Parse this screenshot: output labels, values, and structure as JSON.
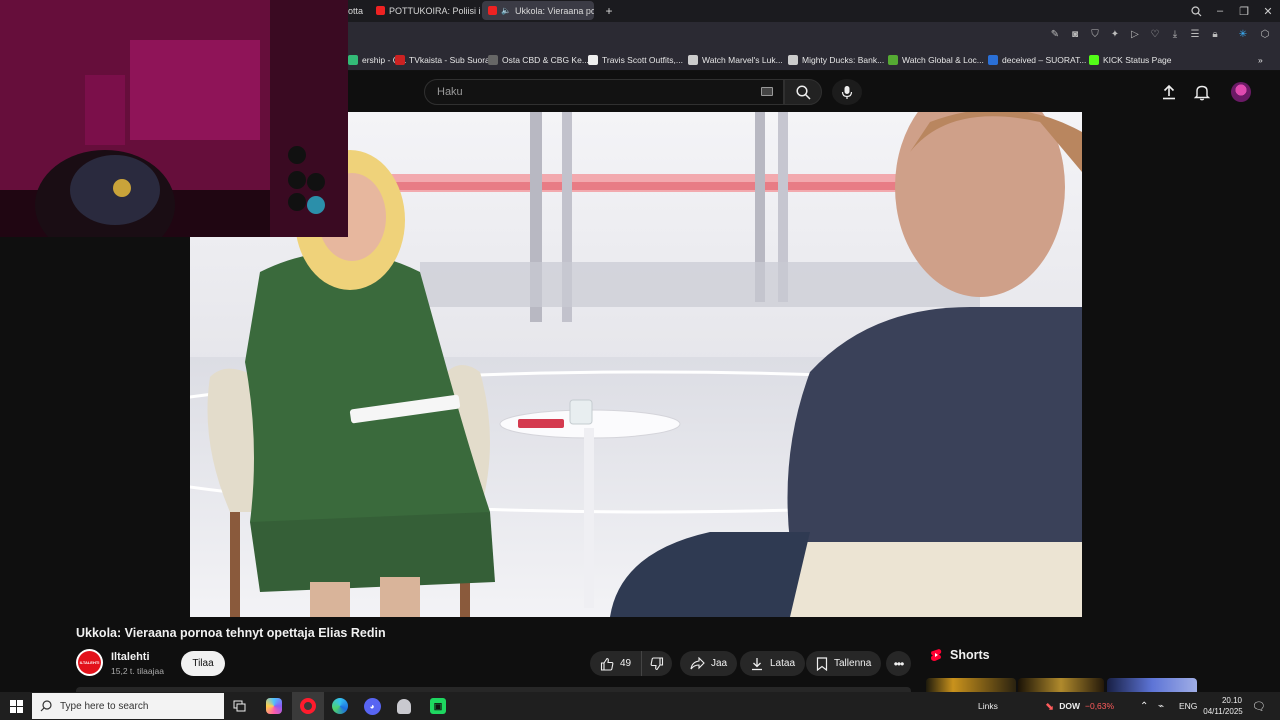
{
  "browser": {
    "tabs": [
      {
        "label": "otta",
        "active": false
      },
      {
        "label": "POTTUKOIRA: Poliisi iskee",
        "active": false
      },
      {
        "label": "Ukkola: Vieraana porno",
        "active": true
      }
    ],
    "new_tab": "+",
    "bookmarks": [
      {
        "label": "ership - G...",
        "color": "#3b7"
      },
      {
        "label": "TVkaista - Sub Suora",
        "color": "#c22"
      },
      {
        "label": "Osta CBD & CBG Ke...",
        "color": "#666"
      },
      {
        "label": "Travis Scott Outfits,...",
        "color": "#eee"
      },
      {
        "label": "Watch Marvel's Luk...",
        "color": "#ccc"
      },
      {
        "label": "Mighty Ducks: Bank...",
        "color": "#ccc"
      },
      {
        "label": "Watch Global & Loc...",
        "color": "#5a3"
      },
      {
        "label": "deceived – SUORAT...",
        "color": "#2a6fd6"
      },
      {
        "label": "KICK Status Page",
        "color": "#53fc18"
      }
    ]
  },
  "youtube": {
    "search_placeholder": "Haku",
    "video_title": "Ukkola: Vieraana pornoa tehnyt opettaja Elias Redin",
    "channel": {
      "name": "Iltalehti",
      "subscribers": "15,2 t. tilaajaa",
      "avatar_text": "ILTALEHTI"
    },
    "subscribe_label": "Tilaa",
    "actions": {
      "likes": "49",
      "share": "Jaa",
      "download": "Lataa",
      "save": "Tallenna"
    },
    "shorts_label": "Shorts"
  },
  "taskbar": {
    "search_placeholder": "Type here to search",
    "links_label": "Links",
    "ticker_name": "DOW",
    "ticker_change": "−0,63%",
    "language": "ENG",
    "time": "20.10",
    "date": "04/11/2025"
  },
  "colors": {
    "accent_red": "#ff0033",
    "ticker_negative": "#ff5c5c",
    "taskbar_bg": "#1f1f1f"
  }
}
